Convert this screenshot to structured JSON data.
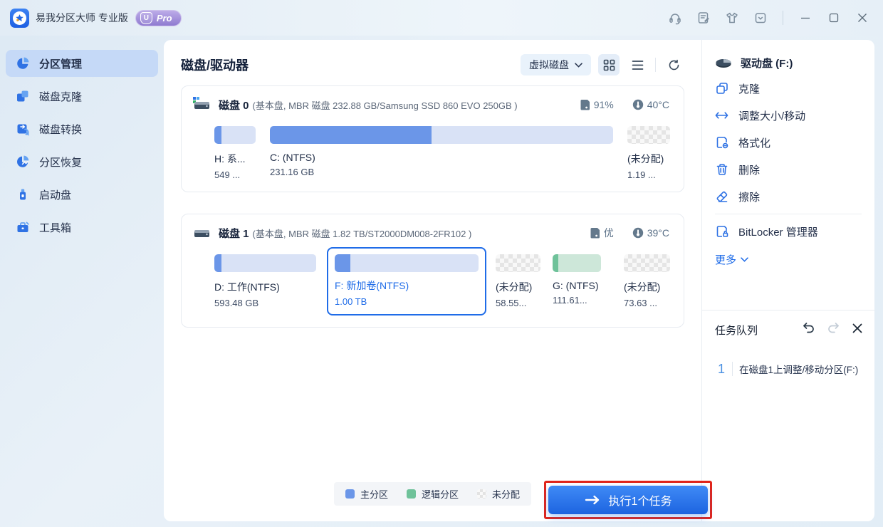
{
  "titlebar": {
    "app_title": "易我分区大师 专业版",
    "pro_letter": "U",
    "pro_label": "Pro"
  },
  "sidebar": {
    "items": [
      {
        "label": "分区管理",
        "active": true
      },
      {
        "label": "磁盘克隆",
        "active": false
      },
      {
        "label": "磁盘转换",
        "active": false
      },
      {
        "label": "分区恢复",
        "active": false
      },
      {
        "label": "启动盘",
        "active": false
      },
      {
        "label": "工具箱",
        "active": false
      }
    ]
  },
  "main": {
    "title": "磁盘/驱动器",
    "filter_label": "虚拟磁盘",
    "disks": [
      {
        "name": "磁盘 0",
        "details": "(基本盘, MBR 磁盘 232.88 GB/Samsung SSD 860 EVO 250GB )",
        "usage": "91%",
        "temp": "40°C",
        "partitions": [
          {
            "label": "H: 系...",
            "size": "549 ...",
            "type": "primary"
          },
          {
            "label": "C: (NTFS)",
            "size": "231.16 GB",
            "type": "primary"
          },
          {
            "label": "(未分配)",
            "size": "1.19 ...",
            "type": "unallocated"
          }
        ]
      },
      {
        "name": "磁盘 1",
        "details": "(基本盘, MBR 磁盘 1.82 TB/ST2000DM008-2FR102 )",
        "usage": "优",
        "temp": "39°C",
        "partitions": [
          {
            "label": "D: 工作(NTFS)",
            "size": "593.48 GB",
            "type": "primary"
          },
          {
            "label": "F: 新加卷(NTFS)",
            "size": "1.00 TB",
            "type": "primary",
            "selected": true
          },
          {
            "label": "(未分配)",
            "size": "58.55...",
            "type": "unallocated"
          },
          {
            "label": "G: (NTFS)",
            "size": "111.61...",
            "type": "logical"
          },
          {
            "label": "(未分配)",
            "size": "73.63 ...",
            "type": "unallocated"
          }
        ]
      }
    ],
    "legend": [
      {
        "label": "主分区",
        "color": "#6b96e8"
      },
      {
        "label": "逻辑分区",
        "color": "#6fc29a"
      },
      {
        "label": "未分配",
        "color": "checker"
      }
    ]
  },
  "right": {
    "drive_label": "驱动盘  (F:)",
    "actions": [
      {
        "label": "克隆"
      },
      {
        "label": "调整大小/移动"
      },
      {
        "label": "格式化"
      },
      {
        "label": "删除"
      },
      {
        "label": "擦除"
      }
    ],
    "bitlocker_label": "BitLocker 管理器",
    "more_label": "更多",
    "queue_title": "任务队列",
    "task": {
      "num": "1",
      "text": "在磁盘1上调整/移动分区(F:)"
    },
    "execute_label": "执行1个任务"
  },
  "colors": {
    "accent": "#1f6ce8",
    "primary_partition": "#6b96e8",
    "logical_partition": "#6fc29a",
    "annotation_red": "#e1251b"
  }
}
